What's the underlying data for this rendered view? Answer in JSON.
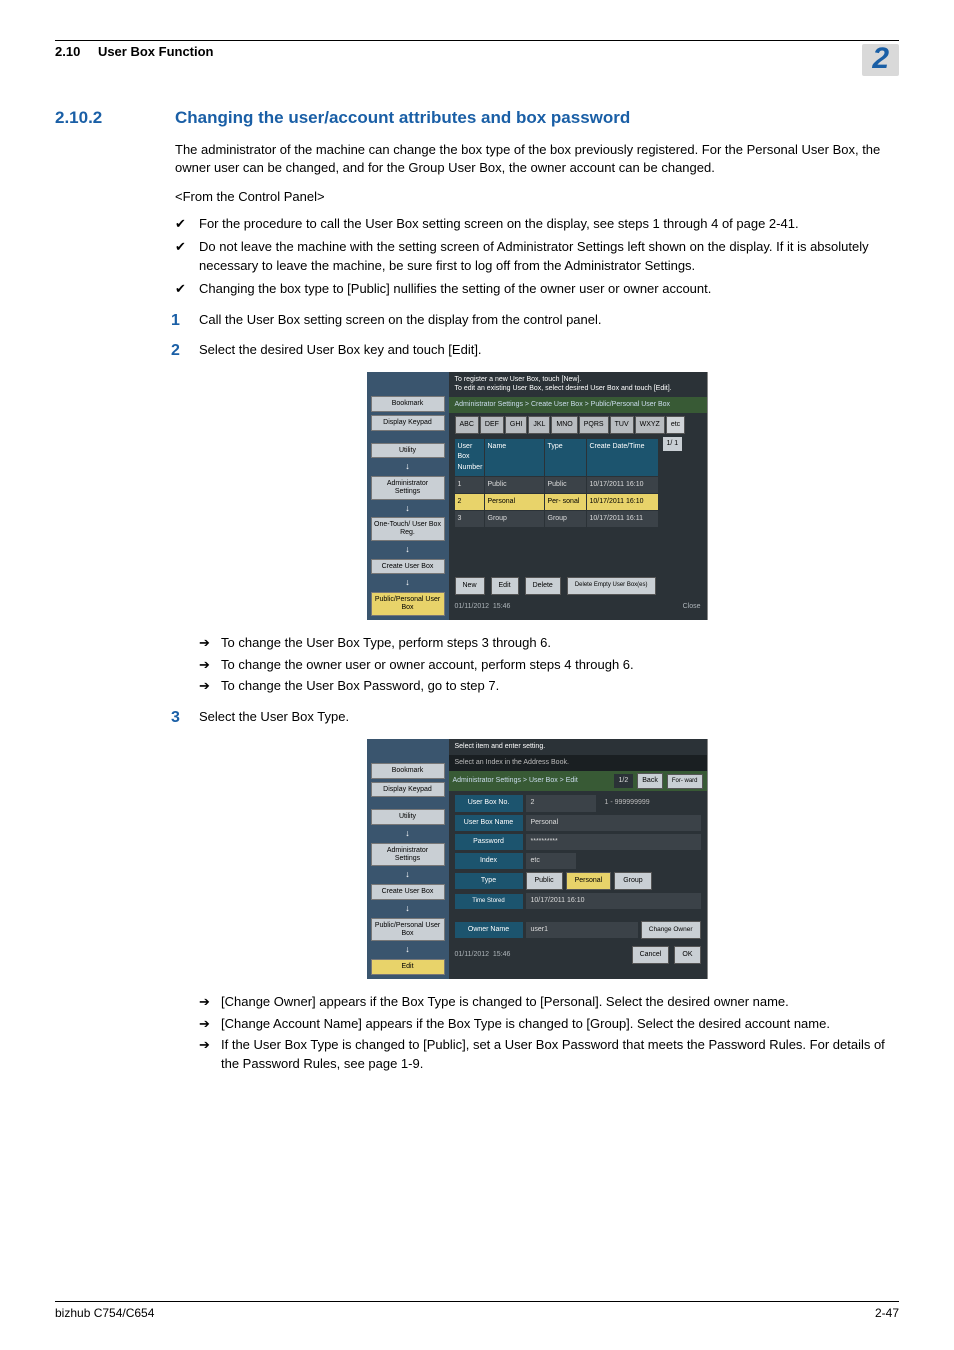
{
  "header": {
    "section_number": "2.10",
    "section_title": "User Box Function",
    "chapter_badge": "2"
  },
  "heading": {
    "number": "2.10.2",
    "title": "Changing the user/account attributes and box password"
  },
  "intro": "The administrator of the machine can change the box type of the box previously registered. For the Personal User Box, the owner user can be changed, and for the Group User Box, the owner account can be changed.",
  "subhead": "<From the Control Panel>",
  "checks": [
    "For the procedure to call the User Box setting screen on the display, see steps 1 through 4 of page 2-41.",
    "Do not leave the machine with the setting screen of Administrator Settings left shown on the display. If it is absolutely necessary to leave the machine, be sure first to log off from the Administrator Settings.",
    "Changing the box type to [Public] nullifies the setting of the owner user or owner account."
  ],
  "step1": {
    "num": "1",
    "text": "Call the User Box setting screen on the display from the control panel."
  },
  "step2": {
    "num": "2",
    "text": "Select the desired User Box key and touch [Edit]."
  },
  "arrows1": [
    "To change the User Box Type, perform steps 3 through 6.",
    "To change the owner user or owner account, perform steps 4 through 6.",
    "To change the User Box Password, go to step 7."
  ],
  "step3": {
    "num": "3",
    "text": "Select the User Box Type."
  },
  "arrows2": [
    "[Change Owner] appears if the Box Type is changed to [Personal]. Select the desired owner name.",
    "[Change Account Name] appears if the Box Type is changed to [Group]. Select the desired account name.",
    "If the User Box Type is changed to [Public], set a User Box Password that meets the Password Rules. For details of the Password Rules, see page 1-9."
  ],
  "ui1": {
    "sidebar": {
      "bookmark": "Bookmark",
      "display_keypad": "Display Keypad",
      "utility": "Utility",
      "admin_settings": "Administrator Settings",
      "one_touch": "One-Touch/\nUser Box Reg.",
      "create_user_box": "Create User Box",
      "public_personal": "Public/Personal User Box"
    },
    "instr1": "To register a new User Box, touch [New].",
    "instr2": "To edit an existing User Box, select desired User Box and touch [Edit].",
    "breadcrumb": "Administrator Settings > Create User Box > Public/Personal User Box",
    "tabs": [
      "ABC",
      "DEF",
      "GHI",
      "JKL",
      "MNO",
      "PQRS",
      "TUV",
      "WXYZ",
      "etc"
    ],
    "table": {
      "headers": {
        "num": "User Box Number",
        "name": "Name",
        "type": "Type",
        "date": "Create Date/Time"
      },
      "rows": [
        {
          "num": "1",
          "name": "Public",
          "type": "Public",
          "date": "10/17/2011 16:10"
        },
        {
          "num": "2",
          "name": "Personal",
          "type": "Per- sonal",
          "date": "10/17/2011 16:10"
        },
        {
          "num": "3",
          "name": "Group",
          "type": "Group",
          "date": "10/17/2011 16:11"
        }
      ]
    },
    "pager": "1/ 1",
    "actions": {
      "new": "New",
      "edit": "Edit",
      "delete": "Delete",
      "delete_empty": "Delete Empty User Box(es)"
    },
    "footer": {
      "date": "01/11/2012",
      "time": "15:46",
      "close": "Close"
    }
  },
  "ui2": {
    "sidebar": {
      "bookmark": "Bookmark",
      "display_keypad": "Display Keypad",
      "utility": "Utility",
      "admin_settings": "Administrator Settings",
      "create_user_box": "Create User Box",
      "public_personal": "Public/Personal User Box",
      "edit": "Edit"
    },
    "instr": "Select item and enter setting.",
    "subinstr": "Select an Index in the Address Book.",
    "breadcrumb": "Administrator Settings > User Box > Edit",
    "page": "1/2",
    "back": "Back",
    "forward": "For- ward",
    "fields": {
      "no_label": "User Box No.",
      "no_val": "2",
      "no_range": "1 - 999999999",
      "name_label": "User Box Name",
      "name_val": "Personal",
      "pwd_label": "Password",
      "pwd_val": "**********",
      "index_label": "Index",
      "index_val": "etc",
      "type_label": "Type",
      "type_opts": {
        "public": "Public",
        "personal": "Personal",
        "group": "Group"
      },
      "time_label": "Time Stored",
      "time_val": "10/17/2011  16:10",
      "owner_label": "Owner Name",
      "owner_val": "user1",
      "change_owner": "Change Owner"
    },
    "footer": {
      "date": "01/11/2012",
      "time": "15:46",
      "cancel": "Cancel",
      "ok": "OK"
    }
  },
  "footer": {
    "left": "bizhub C754/C654",
    "right": "2-47"
  }
}
